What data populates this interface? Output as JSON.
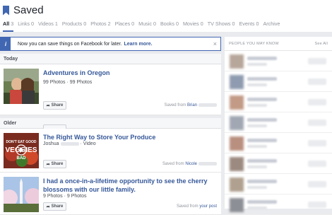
{
  "header": {
    "title": "Saved"
  },
  "tabs": [
    {
      "label": "All",
      "count": "3"
    },
    {
      "label": "Links",
      "count": "0"
    },
    {
      "label": "Videos",
      "count": "1"
    },
    {
      "label": "Products",
      "count": "0"
    },
    {
      "label": "Photos",
      "count": "2"
    },
    {
      "label": "Places",
      "count": "0"
    },
    {
      "label": "Music",
      "count": "0"
    },
    {
      "label": "Books",
      "count": "0"
    },
    {
      "label": "Movies",
      "count": "0"
    },
    {
      "label": "TV Shows",
      "count": "0"
    },
    {
      "label": "Events",
      "count": "0"
    },
    {
      "label": "Archive",
      "count": ""
    }
  ],
  "notice": {
    "text": "Now you can save things on Facebook for later.",
    "link": "Learn more.",
    "close": "×",
    "icon": "info-icon"
  },
  "sections": {
    "today": "Today",
    "older": "Older"
  },
  "items": [
    {
      "title": "Adventures in Oregon",
      "meta": "99 Photos · 99 Photos",
      "share": "Share",
      "saved_prefix": "Saved from",
      "saved_who": "Brian"
    },
    {
      "title": "The Right Way to Store Your Produce",
      "meta_name": "Joshua",
      "meta_rest": "· Video",
      "share": "Share",
      "saved_prefix": "Saved from",
      "saved_who": "Nicole"
    },
    {
      "title": "I had a once-in-a-lifetime opportunity to see the cherry blossoms with our little family.",
      "meta": "9 Photos · 9 Photos",
      "share": "Share",
      "saved_prefix": "Saved from",
      "saved_who": "your post"
    }
  ],
  "video_thumb_text": "DON'T EAT GOOD VEGGIES BAD",
  "sidebar": {
    "heading": "PEOPLE YOU MAY KNOW",
    "see_all": "See All"
  },
  "colors": {
    "accent": "#4267b2",
    "link": "#365899"
  }
}
